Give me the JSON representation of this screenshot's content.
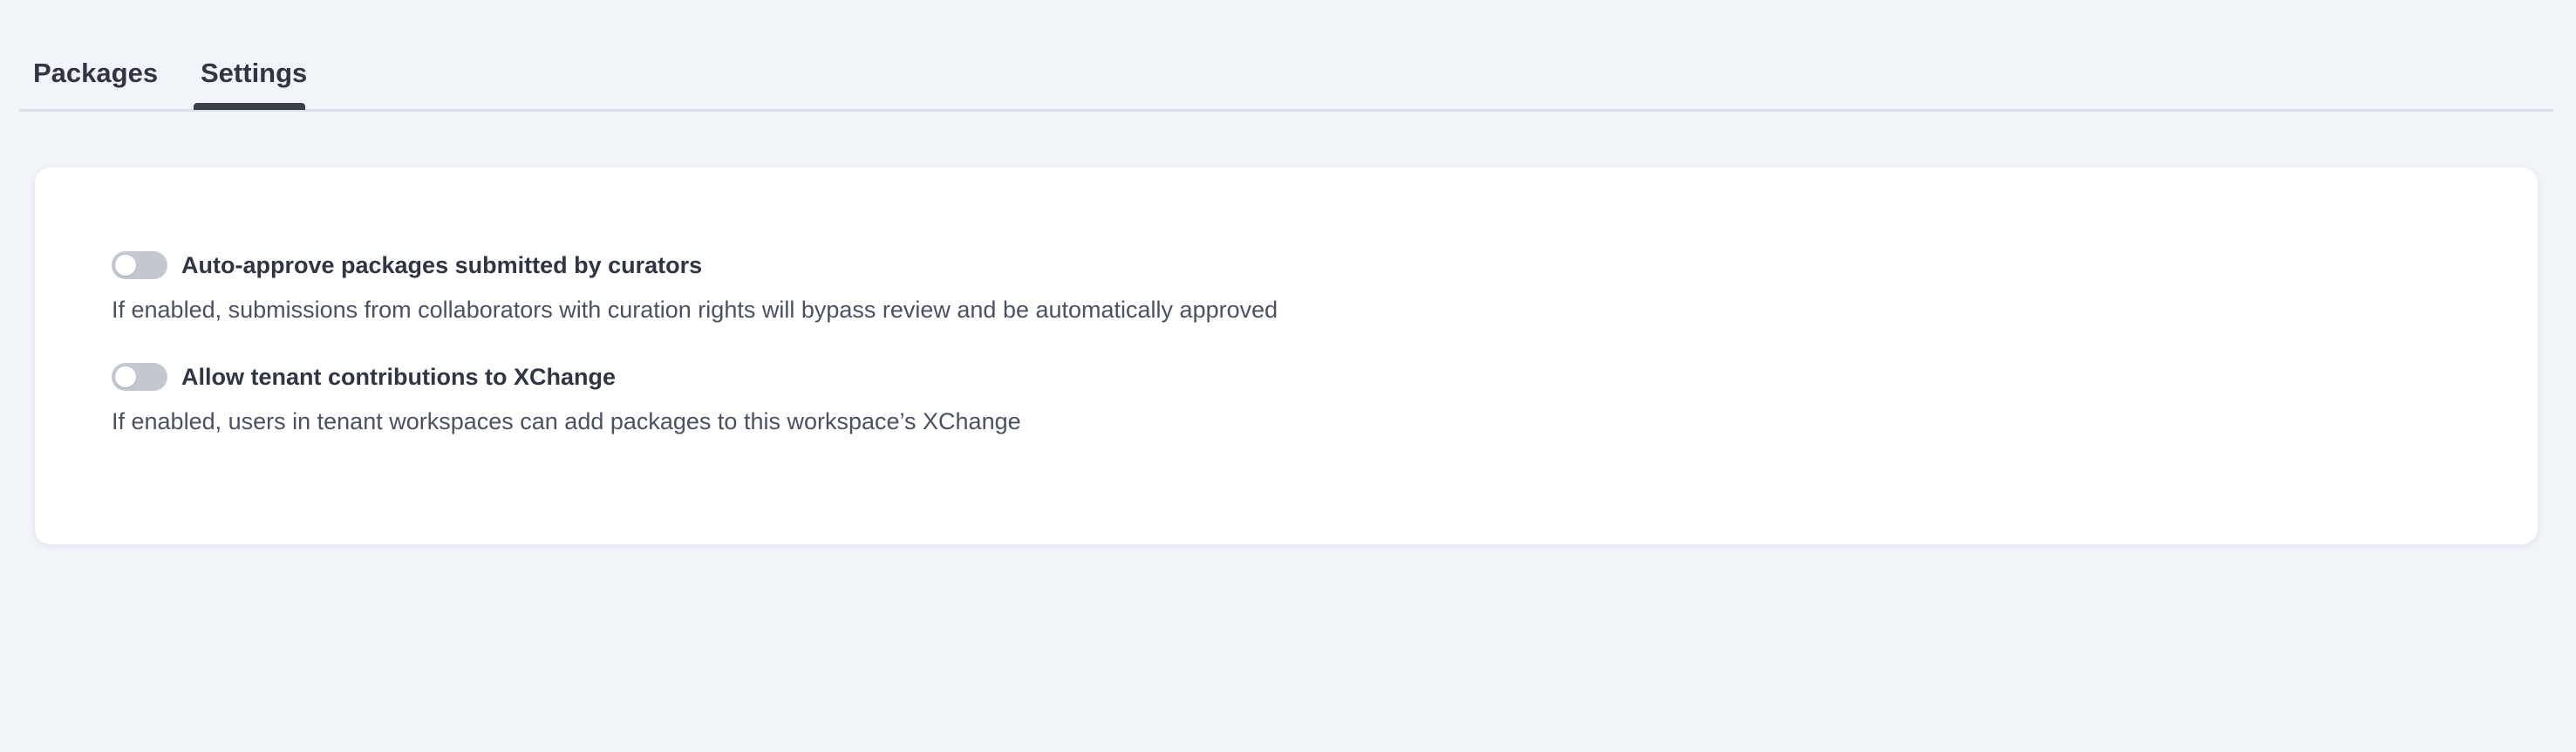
{
  "tabs": {
    "items": [
      {
        "label": "Packages",
        "active": false
      },
      {
        "label": "Settings",
        "active": true
      }
    ]
  },
  "settings": {
    "items": [
      {
        "label": "Auto-approve packages submitted by curators",
        "description": "If enabled, submissions from collaborators with curation rights will bypass review and be automatically approved",
        "enabled": false
      },
      {
        "label": "Allow tenant contributions to XChange",
        "description": "If enabled, users in tenant workspaces can add packages to this workspace’s XChange",
        "enabled": false
      }
    ]
  },
  "colors": {
    "page_background": "#f1f4f9",
    "card_background": "#ffffff",
    "toggle_off": "#c3c7cf",
    "active_tab_indicator": "#3a4049",
    "text_primary": "#2f3542",
    "text_secondary": "#4a5160"
  },
  "icons": {
    "toggle": "toggle-switch-off"
  }
}
